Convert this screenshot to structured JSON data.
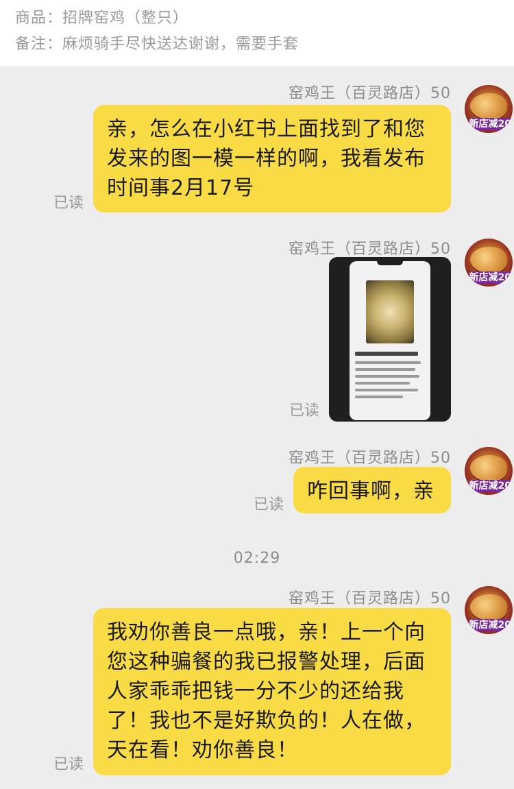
{
  "order": {
    "product_label": "商品：",
    "product_value": "招牌窑鸡（整只）",
    "note_label": "备注：",
    "note_value": "麻烦骑手尽快送达谢谢，需要手套"
  },
  "messages": [
    {
      "sender": "窑鸡王（百灵路店）50",
      "type": "text",
      "text": "亲，怎么在小红书上面找到了和您发来的图一模一样的啊，我看发布时间事2月17号",
      "read_status": "已读"
    },
    {
      "sender": "窑鸡王（百灵路店）50",
      "type": "image",
      "read_status": "已读"
    },
    {
      "sender": "窑鸡王（百灵路店）50",
      "type": "text",
      "text": "咋回事啊，亲",
      "read_status": "已读"
    },
    {
      "sender": "窑鸡王（百灵路店）50",
      "type": "text",
      "text": "我劝你善良一点哦，亲！上一个向您这种骗餐的我已报警处理，后面人家乖乖把钱一分不少的还给我了！我也不是好欺负的！人在做，天在看！劝你善良！",
      "read_status": "已读"
    }
  ],
  "timestamp": "02:29",
  "avatar_badge": "新店减20",
  "colors": {
    "bubble": "#f9dc45",
    "background": "#ededed",
    "meta_text": "#8c8c8c"
  }
}
